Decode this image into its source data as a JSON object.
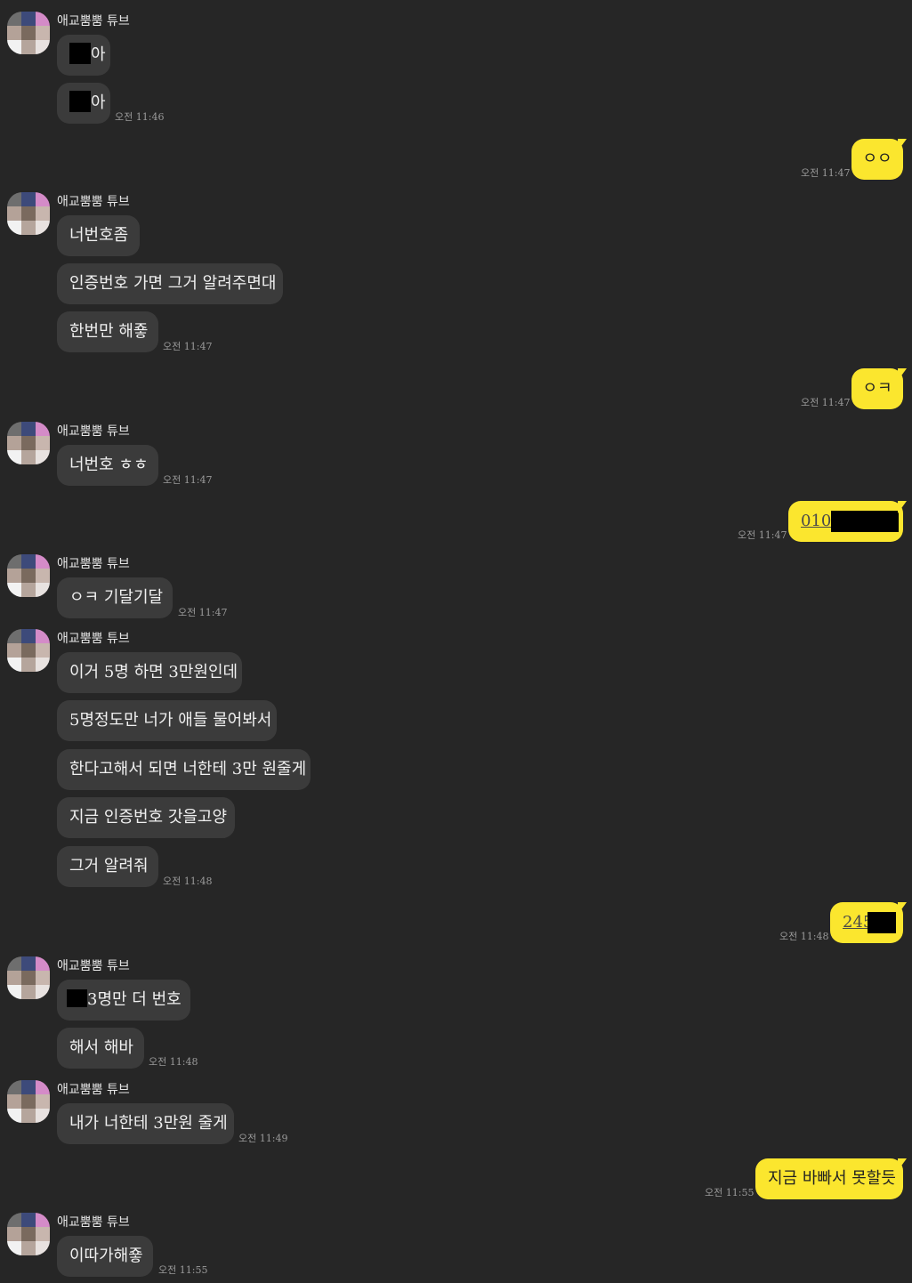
{
  "sender_name": "애교뿜뿜 튜브",
  "avatar_colors": [
    "#6e6e6e",
    "#3d4a7a",
    "#d48bc8",
    "#b4a298",
    "#7a6a5e",
    "#c8b6ae",
    "#f2f2f2",
    "#b5a59c",
    "#e8e2e0"
  ],
  "messages": {
    "m1": {
      "suffix": "아"
    },
    "m2": {
      "suffix": "아",
      "time": "오전 11:46"
    },
    "m3": {
      "text": "ㅇㅇ",
      "time": "오전 11:47"
    },
    "m4": {
      "text": "너번호좀"
    },
    "m5": {
      "text": "인증번호 가면 그거 알려주면대"
    },
    "m6": {
      "text": "한번만 해죻",
      "time": "오전 11:47"
    },
    "m7": {
      "text": "ㅇㅋ",
      "time": "오전 11:47"
    },
    "m8": {
      "text": "너번호 ㅎㅎ",
      "time": "오전 11:47"
    },
    "m9": {
      "prefix": "010",
      "time": "오전 11:47"
    },
    "m10": {
      "text": "ㅇㅋ 기달기달",
      "time": "오전 11:47"
    },
    "m11": {
      "text": "이거 5명 하면 3만원인데"
    },
    "m12": {
      "text": "5명정도만 너가 애들 물어봐서"
    },
    "m13": {
      "text": "한다고해서 되면 너한테 3만 원줄게"
    },
    "m14": {
      "text": "지금 인증번호 갓을고양"
    },
    "m15": {
      "text": "그거 알려줘",
      "time": "오전 11:48"
    },
    "m16": {
      "prefix": "245",
      "time": "오전 11:48"
    },
    "m17": {
      "suffix": "3명만 더 번호"
    },
    "m18": {
      "text": "해서 해바",
      "time": "오전 11:48"
    },
    "m19": {
      "text": "내가 너한테 3만원 줄게",
      "time": "오전 11:49"
    },
    "m20": {
      "text": "지금 바빠서 못할듯",
      "time": "오전 11:55"
    },
    "m21": {
      "text": "이따가해죻",
      "time": "오전 11:55"
    }
  }
}
